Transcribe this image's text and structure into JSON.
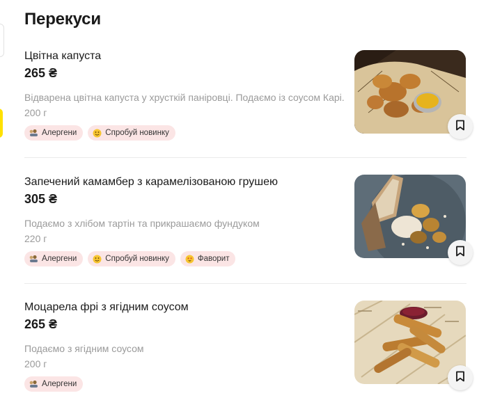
{
  "section": {
    "title": "Перекуси"
  },
  "colors": {
    "badge_bg": "#fbe5e5",
    "accent_yellow": "#ffe100",
    "muted_text": "#9a9a9a"
  },
  "items": [
    {
      "name": "Цвітна капуста",
      "price": "265 ₴",
      "description": "Відварена цвітна капуста у хрусткій паніровці. Подаємо із соусом Карі.",
      "weight": "200 г",
      "badges": [
        {
          "icon": "allergens-icon",
          "label": "Алергени"
        },
        {
          "icon": "smile-icon",
          "label": "Спробуй новинку"
        }
      ],
      "image_icon": "fried-cauliflower-photo",
      "save_icon": "bookmark-icon"
    },
    {
      "name": "Запечений камамбер з карамелізованою грушею",
      "price": "305 ₴",
      "description": "Подаємо з хлібом тартін та прикрашаємо фундуком",
      "weight": "220 г",
      "badges": [
        {
          "icon": "allergens-icon",
          "label": "Алергени"
        },
        {
          "icon": "smile-icon",
          "label": "Спробуй новинку"
        },
        {
          "icon": "star-eyes-icon",
          "label": "Фаворит"
        }
      ],
      "image_icon": "baked-camembert-photo",
      "save_icon": "bookmark-icon"
    },
    {
      "name": "Моцарела фрі з ягідним соусом",
      "price": "265 ₴",
      "description": "Подаємо з ягідним соусом",
      "weight": "200 г",
      "badges": [
        {
          "icon": "allergens-icon",
          "label": "Алергени"
        }
      ],
      "image_icon": "mozzarella-sticks-photo",
      "save_icon": "bookmark-icon"
    }
  ]
}
